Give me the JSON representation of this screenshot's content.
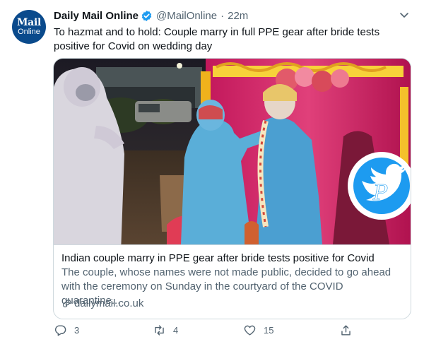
{
  "tweet": {
    "avatar": {
      "line1": "Mail",
      "line2": "Online"
    },
    "name": "Daily Mail Online",
    "handle": "@MailOnline",
    "separator": "·",
    "time": "22m",
    "text": "To hazmat and to hold: Couple marry in full PPE gear after bride tests positive for Covid on wedding day",
    "card": {
      "title": "Indian couple marry in PPE gear after bride tests positive for Covid",
      "description": "The couple, whose names were not made public, decided to go ahead with the ceremony on Sunday in the courtyard of the COVID quarantine...",
      "domain": "dailymail.co.uk"
    },
    "actions": {
      "reply_count": "3",
      "retweet_count": "4",
      "like_count": "15"
    }
  },
  "colors": {
    "brand_blue": "#1d9bf0",
    "avatar_blue": "#0a4a8c",
    "secondary_text": "#536471",
    "border": "#cfd9de"
  },
  "icons": [
    "verified-badge-icon",
    "more-chevron-icon",
    "link-icon",
    "reply-icon",
    "retweet-icon",
    "like-icon",
    "share-icon",
    "twitter-bird-watermark"
  ]
}
